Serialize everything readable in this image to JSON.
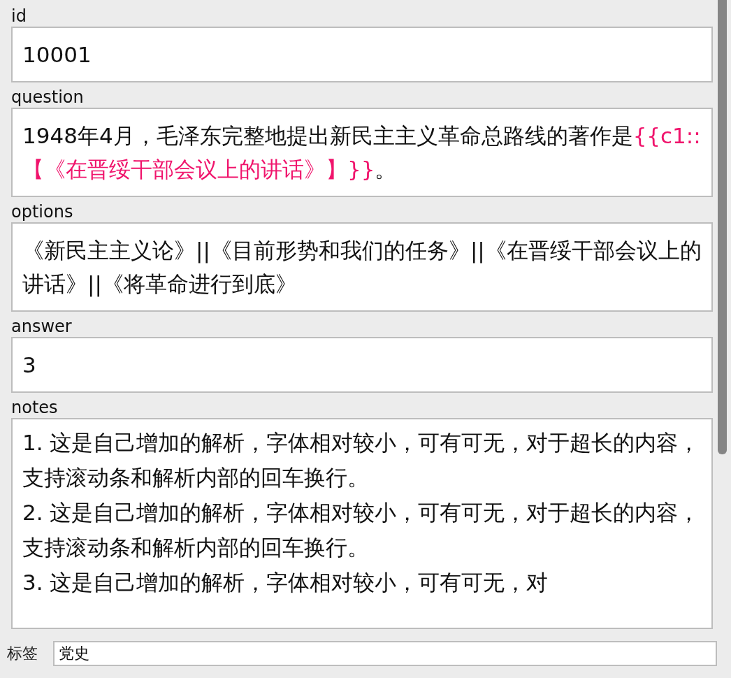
{
  "fields": [
    {
      "label": "id",
      "lines": [
        [
          {
            "kind": "plain",
            "text": "10001"
          }
        ]
      ]
    },
    {
      "label": "question",
      "lines": [
        [
          {
            "kind": "plain",
            "text": "1948年4月，毛泽东完整地提出新民主主义革命总路线的著作是"
          },
          {
            "kind": "cloze",
            "text": "{{c1::【《在晋绥干部会议上的讲话》】}}"
          },
          {
            "kind": "plain",
            "text": "。"
          }
        ]
      ]
    },
    {
      "label": "options",
      "lines": [
        [
          {
            "kind": "plain",
            "text": "《新民主主义论》||《目前形势和我们的任务》||《在晋绥干部会议上的讲话》||《将革命进行到底》"
          }
        ]
      ]
    },
    {
      "label": "answer",
      "lines": [
        [
          {
            "kind": "plain",
            "text": "3"
          }
        ]
      ]
    },
    {
      "label": "notes",
      "lines": [
        [
          {
            "kind": "plain",
            "text": "1. 这是自己增加的解析，字体相对较小，可有可无，对于超长的内容，支持滚动条和解析内部的回车换行。"
          }
        ],
        [
          {
            "kind": "plain",
            "text": "2. 这是自己增加的解析，字体相对较小，可有可无，对于超长的内容，支持滚动条和解析内部的回车换行。"
          }
        ],
        [
          {
            "kind": "plain",
            "text": "3. 这是自己增加的解析，字体相对较小，可有可无，对"
          }
        ]
      ]
    }
  ],
  "tags": {
    "label": "标签",
    "value": "党史"
  }
}
